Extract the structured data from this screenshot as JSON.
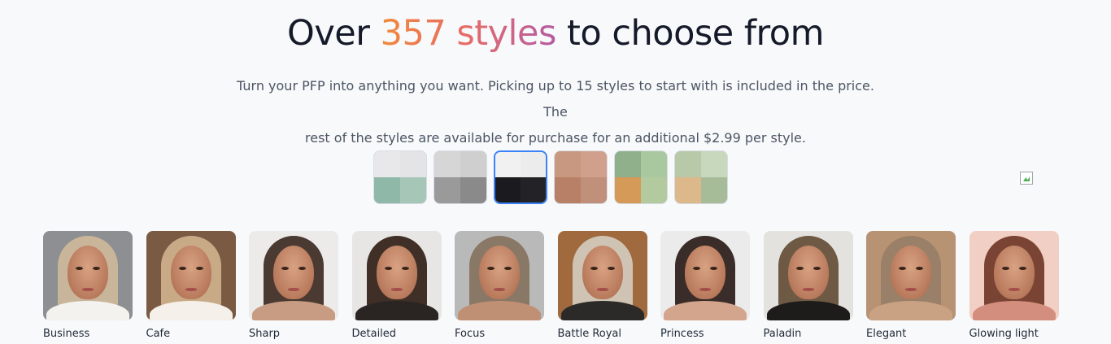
{
  "header": {
    "title_prefix": "Over ",
    "title_highlight": "357 styles",
    "title_suffix": " to choose from",
    "subtitle_line1": "Turn your PFP into anything you want. Picking up to 15 styles to start with is included in the price. The",
    "subtitle_line2": "rest of the styles are available for purchase for an additional $2.99 per style.",
    "highlight_gradient": [
      "#f08a3a",
      "#e96d64",
      "#b45ca4"
    ]
  },
  "source_images": [
    {
      "name": "couple-collage-thumbnail",
      "selected": false
    },
    {
      "name": "man-tuxedo-thumbnail",
      "selected": false
    },
    {
      "name": "woman-tuxedo-thumbnail",
      "selected": true
    },
    {
      "name": "couple-portrait-thumbnail",
      "selected": false
    },
    {
      "name": "orange-cat-thumbnail",
      "selected": false
    },
    {
      "name": "pomeranian-dog-thumbnail",
      "selected": false
    }
  ],
  "broken_image_icon": "broken-image-icon",
  "styles": [
    {
      "label": "Business",
      "bg": "#8d8f92",
      "hair": "#c9b59a",
      "clothes": "#f3f2ef"
    },
    {
      "label": "Cafe",
      "bg": "#7b5a44",
      "hair": "#c8ab86",
      "clothes": "#f5f1ea"
    },
    {
      "label": "Sharp",
      "bg": "#ecebea",
      "hair": "#4a3a32",
      "clothes": "#c79c82"
    },
    {
      "label": "Detailed",
      "bg": "#e8e6e4",
      "hair": "#3f2f27",
      "clothes": "#2a2523"
    },
    {
      "label": "Focus",
      "bg": "#b9b9b9",
      "hair": "#8a7866",
      "clothes": "#c09074"
    },
    {
      "label": "Battle Royal",
      "bg": "#a06a3e",
      "hair": "#cfc4b4",
      "clothes": "#2c2a28"
    },
    {
      "label": "Princess",
      "bg": "#ecebeb",
      "hair": "#3a2c28",
      "clothes": "#d3a58c"
    },
    {
      "label": "Paladin",
      "bg": "#e4e2df",
      "hair": "#6e5a44",
      "clothes": "#1d1c1b"
    },
    {
      "label": "Elegant",
      "bg": "#b89373",
      "hair": "#9a8068",
      "clothes": "#c9a284"
    },
    {
      "label": "Glowing light",
      "bg": "#f2cfc4",
      "hair": "#7a4434",
      "clothes": "#d48e7e"
    }
  ],
  "source_colors": [
    [
      "#e8e8ea",
      "#e4e4e6",
      "#8fb8a8",
      "#a6c7b8"
    ],
    [
      "#d6d6d6",
      "#cfcfcf",
      "#9a9a9a",
      "#8a8a8a"
    ],
    [
      "#f1f1f1",
      "#ececec",
      "#1b1b1f",
      "#232327"
    ],
    [
      "#c89880",
      "#d0a08c",
      "#b88066",
      "#c0907a"
    ],
    [
      "#8fb08a",
      "#a9c8a0",
      "#d69a58",
      "#b3c99e"
    ],
    [
      "#b7c9a9",
      "#c8d8bc",
      "#ddb88a",
      "#a6bc98"
    ]
  ]
}
